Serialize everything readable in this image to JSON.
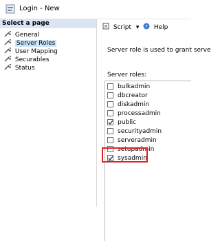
{
  "window": {
    "title": "Login - New"
  },
  "sidebar": {
    "header": "Select a page",
    "items": [
      {
        "label": "General",
        "selected": false
      },
      {
        "label": "Server Roles",
        "selected": true
      },
      {
        "label": "User Mapping",
        "selected": false
      },
      {
        "label": "Securables",
        "selected": false
      },
      {
        "label": "Status",
        "selected": false
      }
    ]
  },
  "toolbar": {
    "script_label": "Script",
    "help_label": "Help"
  },
  "main": {
    "description": "Server role is used to grant serve",
    "roles_label": "Server roles:",
    "roles": [
      {
        "name": "bulkadmin",
        "checked": false
      },
      {
        "name": "dbcreator",
        "checked": false
      },
      {
        "name": "diskadmin",
        "checked": false
      },
      {
        "name": "processadmin",
        "checked": false
      },
      {
        "name": "public",
        "checked": true
      },
      {
        "name": "securityadmin",
        "checked": false
      },
      {
        "name": "serveradmin",
        "checked": false
      },
      {
        "name": "setupadmin",
        "checked": false
      },
      {
        "name": "sysadmin",
        "checked": true
      }
    ]
  },
  "colors": {
    "highlight": "#e02020",
    "selection": "#cce4f7",
    "header_bg": "#d9e5f4"
  }
}
